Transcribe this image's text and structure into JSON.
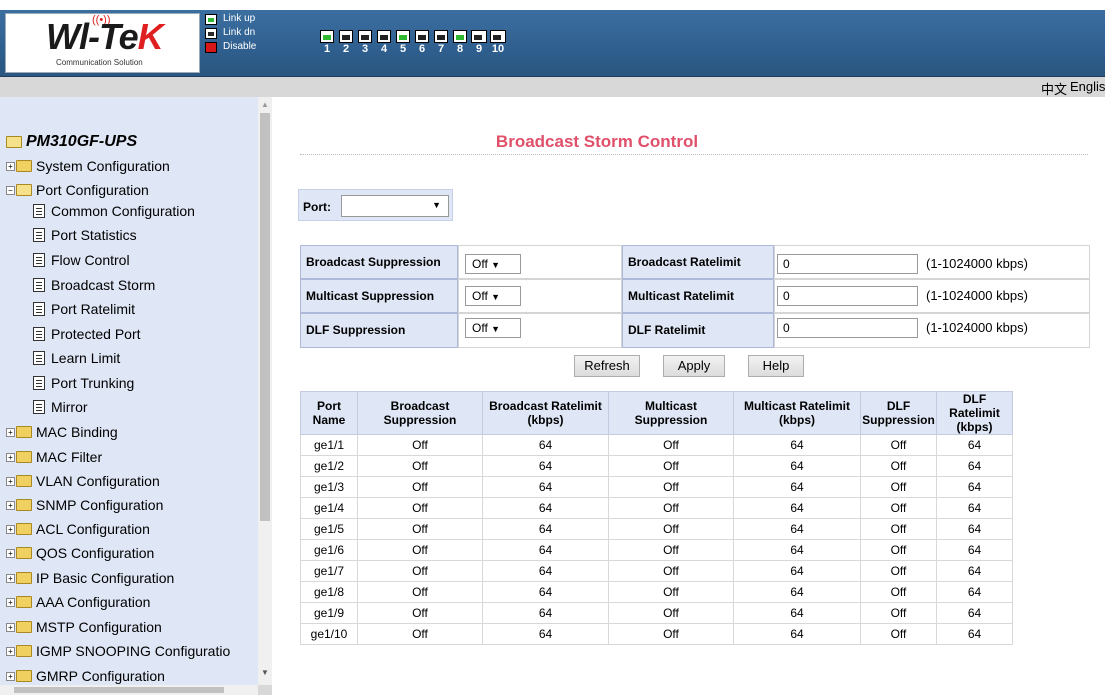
{
  "brand": {
    "logo_text_main": "Wl-Te",
    "logo_text_x": "K",
    "logo_sub": "Communication Solution"
  },
  "legend": [
    {
      "label": "Link up",
      "icon": "port-linkup-icon"
    },
    {
      "label": "Link dn",
      "icon": "port-linkdown-icon"
    },
    {
      "label": "Disable",
      "icon": "port-disable-icon"
    }
  ],
  "ports": [
    {
      "num": "1",
      "state": "up"
    },
    {
      "num": "2",
      "state": "down"
    },
    {
      "num": "3",
      "state": "down"
    },
    {
      "num": "4",
      "state": "down"
    },
    {
      "num": "5",
      "state": "up"
    },
    {
      "num": "6",
      "state": "down"
    },
    {
      "num": "7",
      "state": "down"
    },
    {
      "num": "8",
      "state": "up"
    },
    {
      "num": "9",
      "state": "down"
    },
    {
      "num": "10",
      "state": "down"
    }
  ],
  "lang": {
    "chinese": "中文",
    "english": "English"
  },
  "tree": {
    "root": "PM310GF-UPS",
    "system": "System Configuration",
    "port": "Port Configuration",
    "children": [
      "Common Configuration",
      "Port Statistics",
      "Flow Control",
      "Broadcast Storm",
      "Port Ratelimit",
      "Protected Port",
      "Learn Limit",
      "Port Trunking",
      "Mirror"
    ],
    "folders": [
      "MAC Binding",
      "MAC Filter",
      "VLAN Configuration",
      "SNMP Configuration",
      "ACL Configuration",
      "QOS Configuration",
      "IP Basic Configuration",
      "AAA Configuration",
      "MSTP Configuration",
      "IGMP SNOOPING Configuratio",
      "GMRP Configuration"
    ]
  },
  "page": {
    "title": "Broadcast Storm Control",
    "port_label": "Port:",
    "port_value": ""
  },
  "config": {
    "bc_supp_label": "Broadcast Suppression",
    "bc_supp_value": "Off",
    "bc_rate_label": "Broadcast Ratelimit",
    "bc_rate_value": "0",
    "bc_range": "(1-1024000 kbps)",
    "mc_supp_label": "Multicast Suppression",
    "mc_supp_value": "Off",
    "mc_rate_label": "Multicast Ratelimit",
    "mc_rate_value": "0",
    "mc_range": "(1-1024000 kbps)",
    "dlf_supp_label": "DLF Suppression",
    "dlf_supp_value": "Off",
    "dlf_rate_label": "DLF Ratelimit",
    "dlf_rate_value": "0",
    "dlf_range": "(1-1024000 kbps)"
  },
  "buttons": {
    "refresh": "Refresh",
    "apply": "Apply",
    "help": "Help"
  },
  "table": {
    "headers": [
      "Port Name",
      "Broadcast Suppression",
      "Broadcast Ratelimit (kbps)",
      "Multicast Suppression",
      "Multicast Ratelimit (kbps)",
      "DLF Suppression",
      "DLF Ratelimit (kbps)"
    ],
    "rows": [
      [
        "ge1/1",
        "Off",
        "64",
        "Off",
        "64",
        "Off",
        "64"
      ],
      [
        "ge1/2",
        "Off",
        "64",
        "Off",
        "64",
        "Off",
        "64"
      ],
      [
        "ge1/3",
        "Off",
        "64",
        "Off",
        "64",
        "Off",
        "64"
      ],
      [
        "ge1/4",
        "Off",
        "64",
        "Off",
        "64",
        "Off",
        "64"
      ],
      [
        "ge1/5",
        "Off",
        "64",
        "Off",
        "64",
        "Off",
        "64"
      ],
      [
        "ge1/6",
        "Off",
        "64",
        "Off",
        "64",
        "Off",
        "64"
      ],
      [
        "ge1/7",
        "Off",
        "64",
        "Off",
        "64",
        "Off",
        "64"
      ],
      [
        "ge1/8",
        "Off",
        "64",
        "Off",
        "64",
        "Off",
        "64"
      ],
      [
        "ge1/9",
        "Off",
        "64",
        "Off",
        "64",
        "Off",
        "64"
      ],
      [
        "ge1/10",
        "Off",
        "64",
        "Off",
        "64",
        "Off",
        "64"
      ]
    ]
  },
  "colors": {
    "header_blue": "#2f5f8f",
    "title_pink": "#e0506a",
    "panel_blue": "#dfe6f5"
  }
}
